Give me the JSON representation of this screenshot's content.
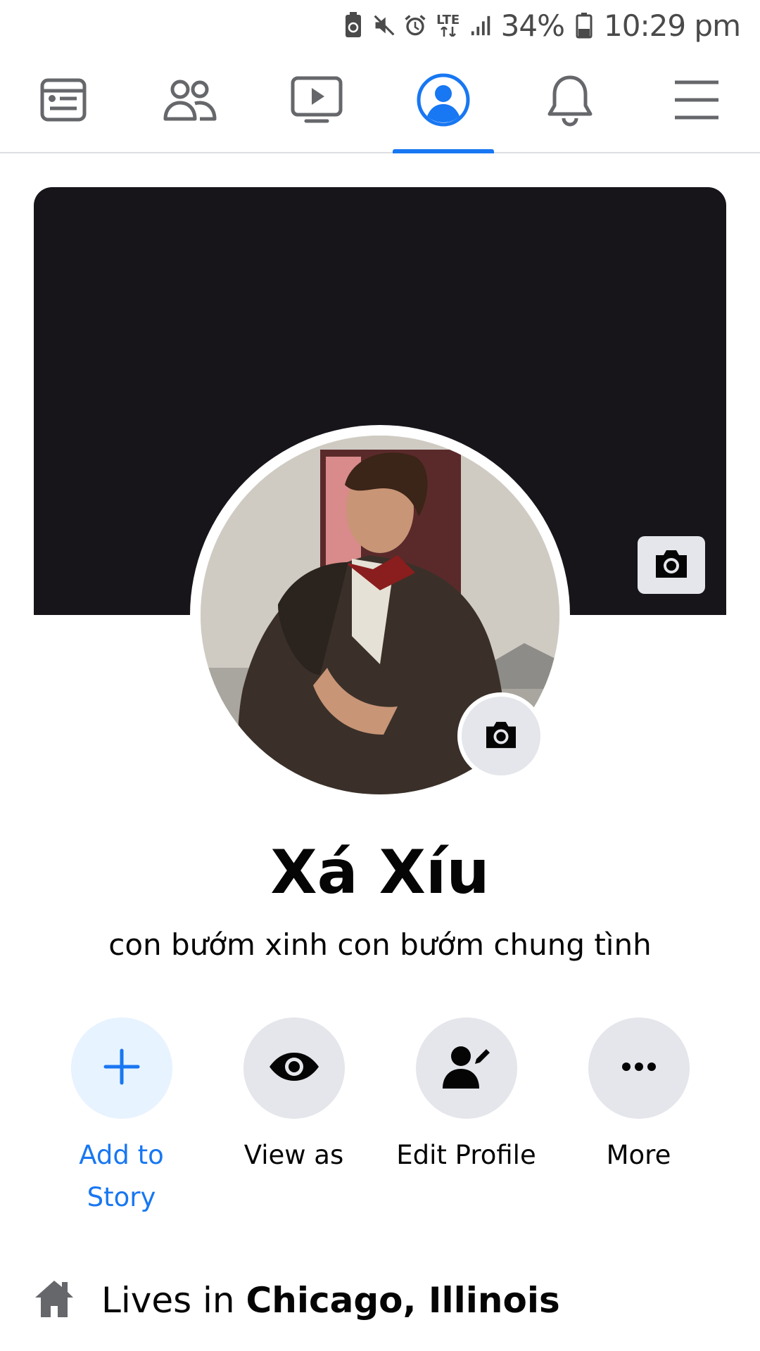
{
  "status_bar": {
    "battery_percent": "34%",
    "time": "10:29 pm",
    "network": "LTE",
    "icons": [
      "battery-saver-icon",
      "mute-icon",
      "alarm-icon",
      "lte-icon",
      "signal-icon",
      "battery-icon"
    ]
  },
  "nav": {
    "active_tab": "profile",
    "tabs": [
      "news-feed-icon",
      "friends-icon",
      "watch-icon",
      "profile-icon",
      "notifications-icon",
      "menu-icon"
    ],
    "accent_color": "#1877f2"
  },
  "profile": {
    "name": "Xá Xíu",
    "bio": "con bướm xinh con bướm chung tình",
    "cover_color": "#17141a"
  },
  "actions": [
    {
      "label": "Add to Story",
      "icon": "plus-icon"
    },
    {
      "label": "View as",
      "icon": "eye-icon"
    },
    {
      "label": "Edit Profile",
      "icon": "edit-profile-icon"
    },
    {
      "label": "More",
      "icon": "more-icon"
    }
  ],
  "intro": {
    "prefix": "Lives in",
    "place": "Chicago, Illinois",
    "icon": "home-icon"
  }
}
